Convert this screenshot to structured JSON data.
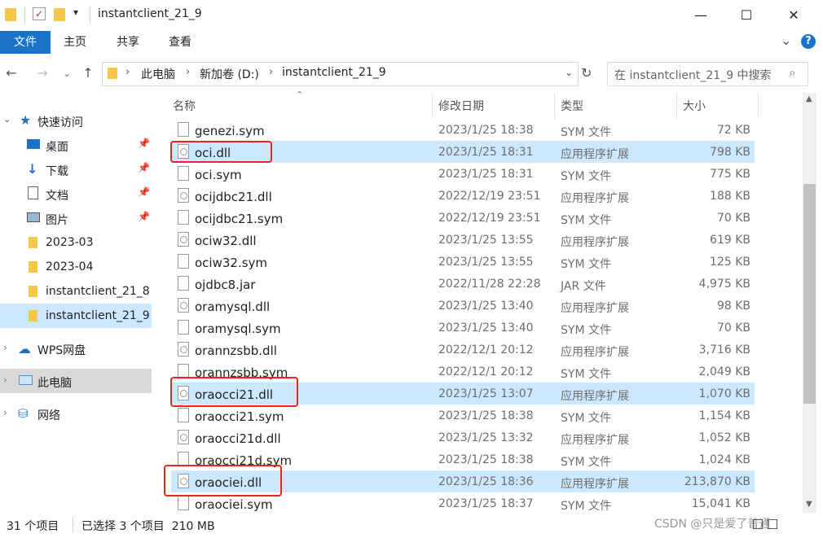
{
  "window": {
    "title": "instantclient_21_9",
    "minimize": "—",
    "maximize": "☐",
    "close": "✕"
  },
  "ribbon": {
    "tabs": [
      "文件",
      "主页",
      "共享",
      "查看"
    ],
    "expand": "⌄",
    "help": "?"
  },
  "address": {
    "crumbs": [
      "此电脑",
      "新加卷 (D:)",
      "instantclient_21_9"
    ],
    "search_placeholder": "在 instantclient_21_9 中搜索"
  },
  "nav": {
    "quick_access": "快速访问",
    "items": [
      {
        "label": "桌面",
        "icon": "desktop-icon",
        "pinned": true
      },
      {
        "label": "下载",
        "icon": "download-icon",
        "pinned": true
      },
      {
        "label": "文档",
        "icon": "document-icon",
        "pinned": true
      },
      {
        "label": "图片",
        "icon": "picture-icon",
        "pinned": true
      },
      {
        "label": "2023-03",
        "icon": "folder-icon",
        "pinned": false
      },
      {
        "label": "2023-04",
        "icon": "folder-icon",
        "pinned": false
      },
      {
        "label": "instantclient_21_8",
        "icon": "folder-icon",
        "pinned": false
      },
      {
        "label": "instantclient_21_9",
        "icon": "folder-icon",
        "pinned": false
      }
    ],
    "wps": "WPS网盘",
    "this_pc": "此电脑",
    "network": "网络"
  },
  "columns": {
    "name": "名称",
    "date": "修改日期",
    "type": "类型",
    "size": "大小"
  },
  "files": [
    {
      "name": "genezi.sym",
      "date": "2023/1/25 18:38",
      "type": "SYM 文件",
      "size": "72 KB",
      "kind": "sym",
      "selected": false
    },
    {
      "name": "oci.dll",
      "date": "2023/1/25 18:31",
      "type": "应用程序扩展",
      "size": "798 KB",
      "kind": "dll",
      "selected": true
    },
    {
      "name": "oci.sym",
      "date": "2023/1/25 18:31",
      "type": "SYM 文件",
      "size": "775 KB",
      "kind": "sym",
      "selected": false
    },
    {
      "name": "ocijdbc21.dll",
      "date": "2022/12/19 23:51",
      "type": "应用程序扩展",
      "size": "188 KB",
      "kind": "dll",
      "selected": false
    },
    {
      "name": "ocijdbc21.sym",
      "date": "2022/12/19 23:51",
      "type": "SYM 文件",
      "size": "70 KB",
      "kind": "sym",
      "selected": false
    },
    {
      "name": "ociw32.dll",
      "date": "2023/1/25 13:55",
      "type": "应用程序扩展",
      "size": "619 KB",
      "kind": "dll",
      "selected": false
    },
    {
      "name": "ociw32.sym",
      "date": "2023/1/25 13:55",
      "type": "SYM 文件",
      "size": "125 KB",
      "kind": "sym",
      "selected": false
    },
    {
      "name": "ojdbc8.jar",
      "date": "2022/11/28 22:28",
      "type": "JAR 文件",
      "size": "4,975 KB",
      "kind": "sym",
      "selected": false
    },
    {
      "name": "oramysql.dll",
      "date": "2023/1/25 13:40",
      "type": "应用程序扩展",
      "size": "98 KB",
      "kind": "dll",
      "selected": false
    },
    {
      "name": "oramysql.sym",
      "date": "2023/1/25 13:40",
      "type": "SYM 文件",
      "size": "70 KB",
      "kind": "sym",
      "selected": false
    },
    {
      "name": "orannzsbb.dll",
      "date": "2022/12/1 20:12",
      "type": "应用程序扩展",
      "size": "3,716 KB",
      "kind": "dll",
      "selected": false
    },
    {
      "name": "orannzsbb.sym",
      "date": "2022/12/1 20:12",
      "type": "SYM 文件",
      "size": "2,049 KB",
      "kind": "sym",
      "selected": false
    },
    {
      "name": "oraocci21.dll",
      "date": "2023/1/25 13:07",
      "type": "应用程序扩展",
      "size": "1,070 KB",
      "kind": "dll",
      "selected": true
    },
    {
      "name": "oraocci21.sym",
      "date": "2023/1/25 18:38",
      "type": "SYM 文件",
      "size": "1,154 KB",
      "kind": "sym",
      "selected": false
    },
    {
      "name": "oraocci21d.dll",
      "date": "2023/1/25 13:32",
      "type": "应用程序扩展",
      "size": "1,052 KB",
      "kind": "dll",
      "selected": false
    },
    {
      "name": "oraocci21d.sym",
      "date": "2023/1/25 18:38",
      "type": "SYM 文件",
      "size": "1,024 KB",
      "kind": "sym",
      "selected": false
    },
    {
      "name": "oraociei.dll",
      "date": "2023/1/25 18:36",
      "type": "应用程序扩展",
      "size": "213,870 KB",
      "kind": "dll",
      "selected": true
    },
    {
      "name": "oraociei.sym",
      "date": "2023/1/25 18:37",
      "type": "SYM 文件",
      "size": "15,041 KB",
      "kind": "sym",
      "selected": false
    }
  ],
  "status": {
    "count": "31 个项目",
    "selection": "已选择 3 个项目  210 MB"
  },
  "watermark": "CSDN @只是爱了普通",
  "colors": {
    "accent": "#1a73c8",
    "selection": "#cce8ff",
    "highlight": "#e8281e"
  }
}
